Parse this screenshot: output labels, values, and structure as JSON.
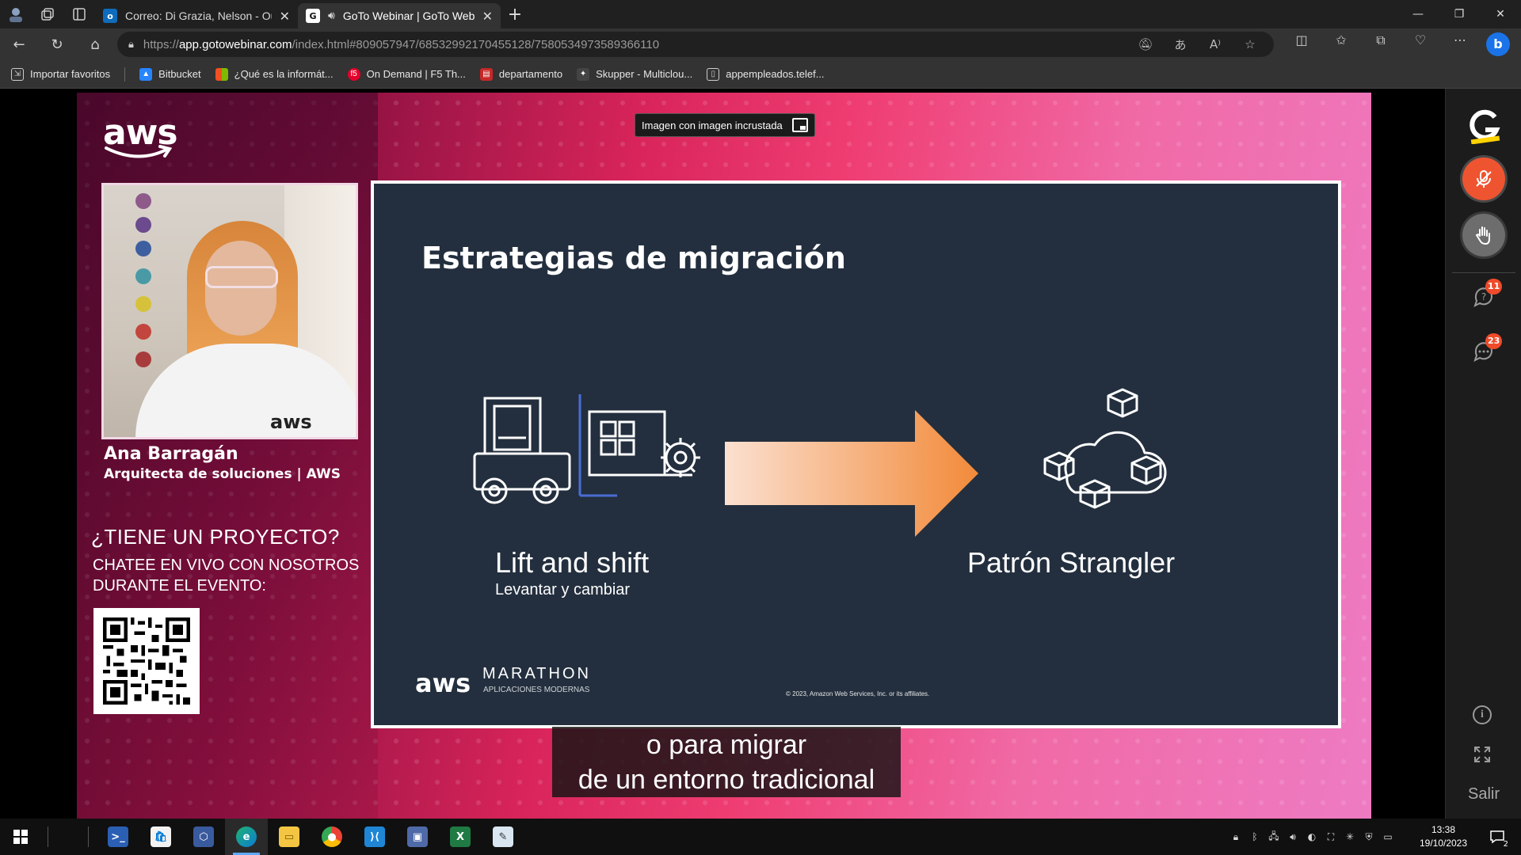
{
  "browser": {
    "tabs": [
      {
        "title": "Correo: Di Grazia, Nelson - Outlo",
        "icon": "outlook-icon",
        "active": false
      },
      {
        "title": "GoTo Webinar | GoTo Webin",
        "icon": "goto-icon",
        "active": true,
        "audio": true
      }
    ],
    "url_prefix": "https://",
    "url_host": "app.gotowebinar.com",
    "url_path": "/index.html#809057947/6853299217045512​8/7580534973589366110",
    "bookmarks": [
      {
        "label": "Importar favoritos",
        "icon": "import-icon"
      },
      {
        "label": "Bitbucket",
        "icon": "bitbucket-icon"
      },
      {
        "label": "¿Qué es la informát...",
        "icon": "microsoft-icon"
      },
      {
        "label": "On Demand | F5 Th...",
        "icon": "f5-icon"
      },
      {
        "label": "departamento",
        "icon": "pdf-icon"
      },
      {
        "label": "Skupper - Multiclou...",
        "icon": "skupper-icon"
      },
      {
        "label": "appempleados.telef...",
        "icon": "page-icon"
      }
    ]
  },
  "webinar": {
    "pip_label": "Imagen con imagen incrustada",
    "brand": "aws",
    "speaker": {
      "name": "Ana Barragán",
      "role": "Arquitecta de soluciones | AWS",
      "hoodie_text": "aws"
    },
    "promo": {
      "title": "¿TIENE UN PROYECTO?",
      "subtitle": "CHATEE EN VIVO CON NOSOTROS DURANTE EL EVENTO:"
    },
    "slide": {
      "title": "Estrategias de migración",
      "left_label": "Lift and shift",
      "left_sub": "Levantar y cambiar",
      "right_label": "Patrón Strangler",
      "footer_brand": "aws",
      "footer_event": "MARATHON",
      "footer_event_sub": "APLICACIONES MODERNAS",
      "copyright": "© 2023, Amazon Web Services, Inc. or its affiliates."
    },
    "caption_line1": "o para migrar",
    "caption_line2": "de un entorno tradicional"
  },
  "sidepanel": {
    "questions_badge": "11",
    "chat_badge": "23",
    "exit_label": "Salir",
    "info_glyph": "i"
  },
  "taskbar": {
    "apps": [
      "powershell-icon",
      "store-icon",
      "virtualbox-icon",
      "edge-icon",
      "file-explorer-icon",
      "chrome-icon",
      "vscode-icon",
      "remote-app-icon",
      "excel-icon",
      "paint-icon"
    ],
    "time": "13:38",
    "date": "19/10/2023",
    "notifications": "2"
  },
  "colors": {
    "slide_bg": "#232f3e",
    "accent_orange": "#f2903f",
    "mic_red": "#ef5430",
    "badge_red": "#ef4b2a"
  }
}
